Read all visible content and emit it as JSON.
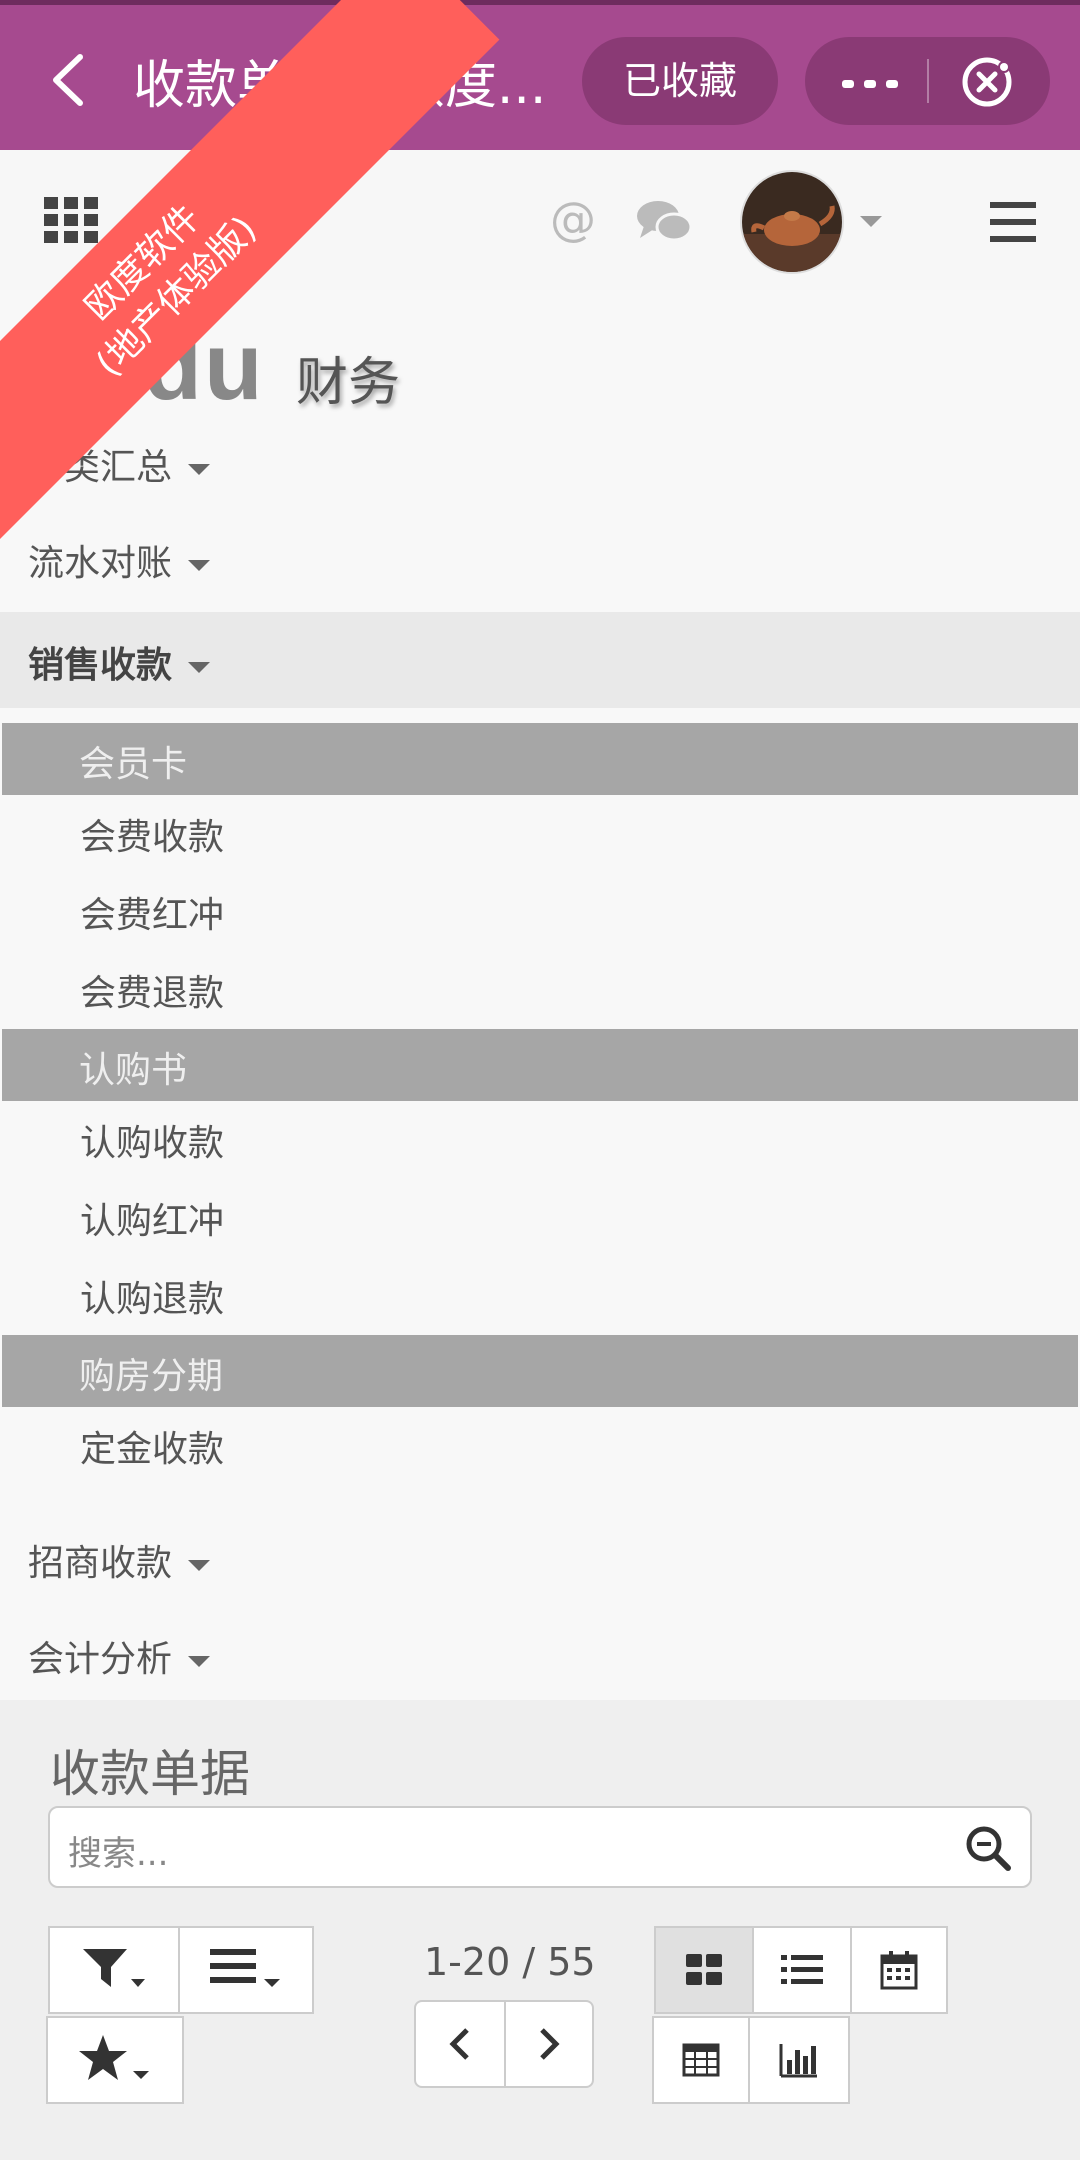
{
  "topbar": {
    "title": "收款单据 - 欧度...",
    "favorite_label": "已收藏"
  },
  "brand": {
    "logo": "Oudu",
    "module": "财务",
    "ribbon_line1": "欧度软件",
    "ribbon_line2": "(地产体验版)"
  },
  "navbar": {
    "mention_symbol": "@"
  },
  "menu": {
    "top_items": [
      "分类汇总",
      "流水对账",
      "销售收款",
      "招商收款",
      "会计分析"
    ],
    "sections": [
      {
        "label": "会员卡",
        "items": [
          "会费收款",
          "会费红冲",
          "会费退款"
        ]
      },
      {
        "label": "认购书",
        "items": [
          "认购收款",
          "认购红冲",
          "认购退款"
        ]
      },
      {
        "label": "购房分期",
        "items": [
          "定金收款"
        ]
      }
    ]
  },
  "control": {
    "title": "收款单据",
    "search_placeholder": "搜索...",
    "pager": "1-20 / 55"
  },
  "colors": {
    "topbar": "#a64a8f",
    "ribbon": "#ff5f5b",
    "section_bg": "#a6a6a6"
  }
}
